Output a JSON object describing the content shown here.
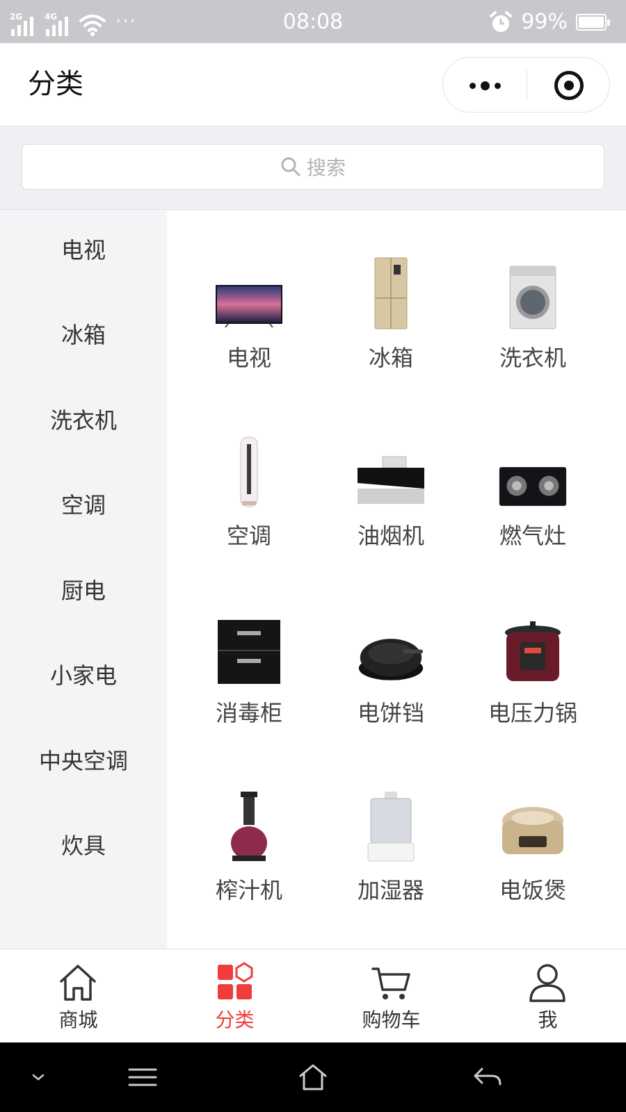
{
  "status_bar": {
    "network_1": "2G",
    "network_2": "4G",
    "more": "···",
    "time": "08:08",
    "battery": "99%",
    "battery_level": 0.99
  },
  "nav": {
    "title": "分类"
  },
  "search": {
    "placeholder": "搜索"
  },
  "sidebar": {
    "items": [
      {
        "label": "电视"
      },
      {
        "label": "冰箱"
      },
      {
        "label": "洗衣机"
      },
      {
        "label": "空调"
      },
      {
        "label": "厨电"
      },
      {
        "label": "小家电"
      },
      {
        "label": "中央空调"
      },
      {
        "label": "炊具"
      }
    ]
  },
  "grid": {
    "items": [
      {
        "label": "电视"
      },
      {
        "label": "冰箱"
      },
      {
        "label": "洗衣机"
      },
      {
        "label": "空调"
      },
      {
        "label": "油烟机"
      },
      {
        "label": "燃气灶"
      },
      {
        "label": "消毒柜"
      },
      {
        "label": "电饼铛"
      },
      {
        "label": "电压力锅"
      },
      {
        "label": "榨汁机"
      },
      {
        "label": "加湿器"
      },
      {
        "label": "电饭煲"
      }
    ]
  },
  "tabbar": {
    "tabs": [
      {
        "label": "商城",
        "icon": "home-icon"
      },
      {
        "label": "分类",
        "icon": "category-icon"
      },
      {
        "label": "购物车",
        "icon": "cart-icon"
      },
      {
        "label": "我",
        "icon": "user-icon"
      }
    ],
    "active_color": "#f03c3c"
  }
}
